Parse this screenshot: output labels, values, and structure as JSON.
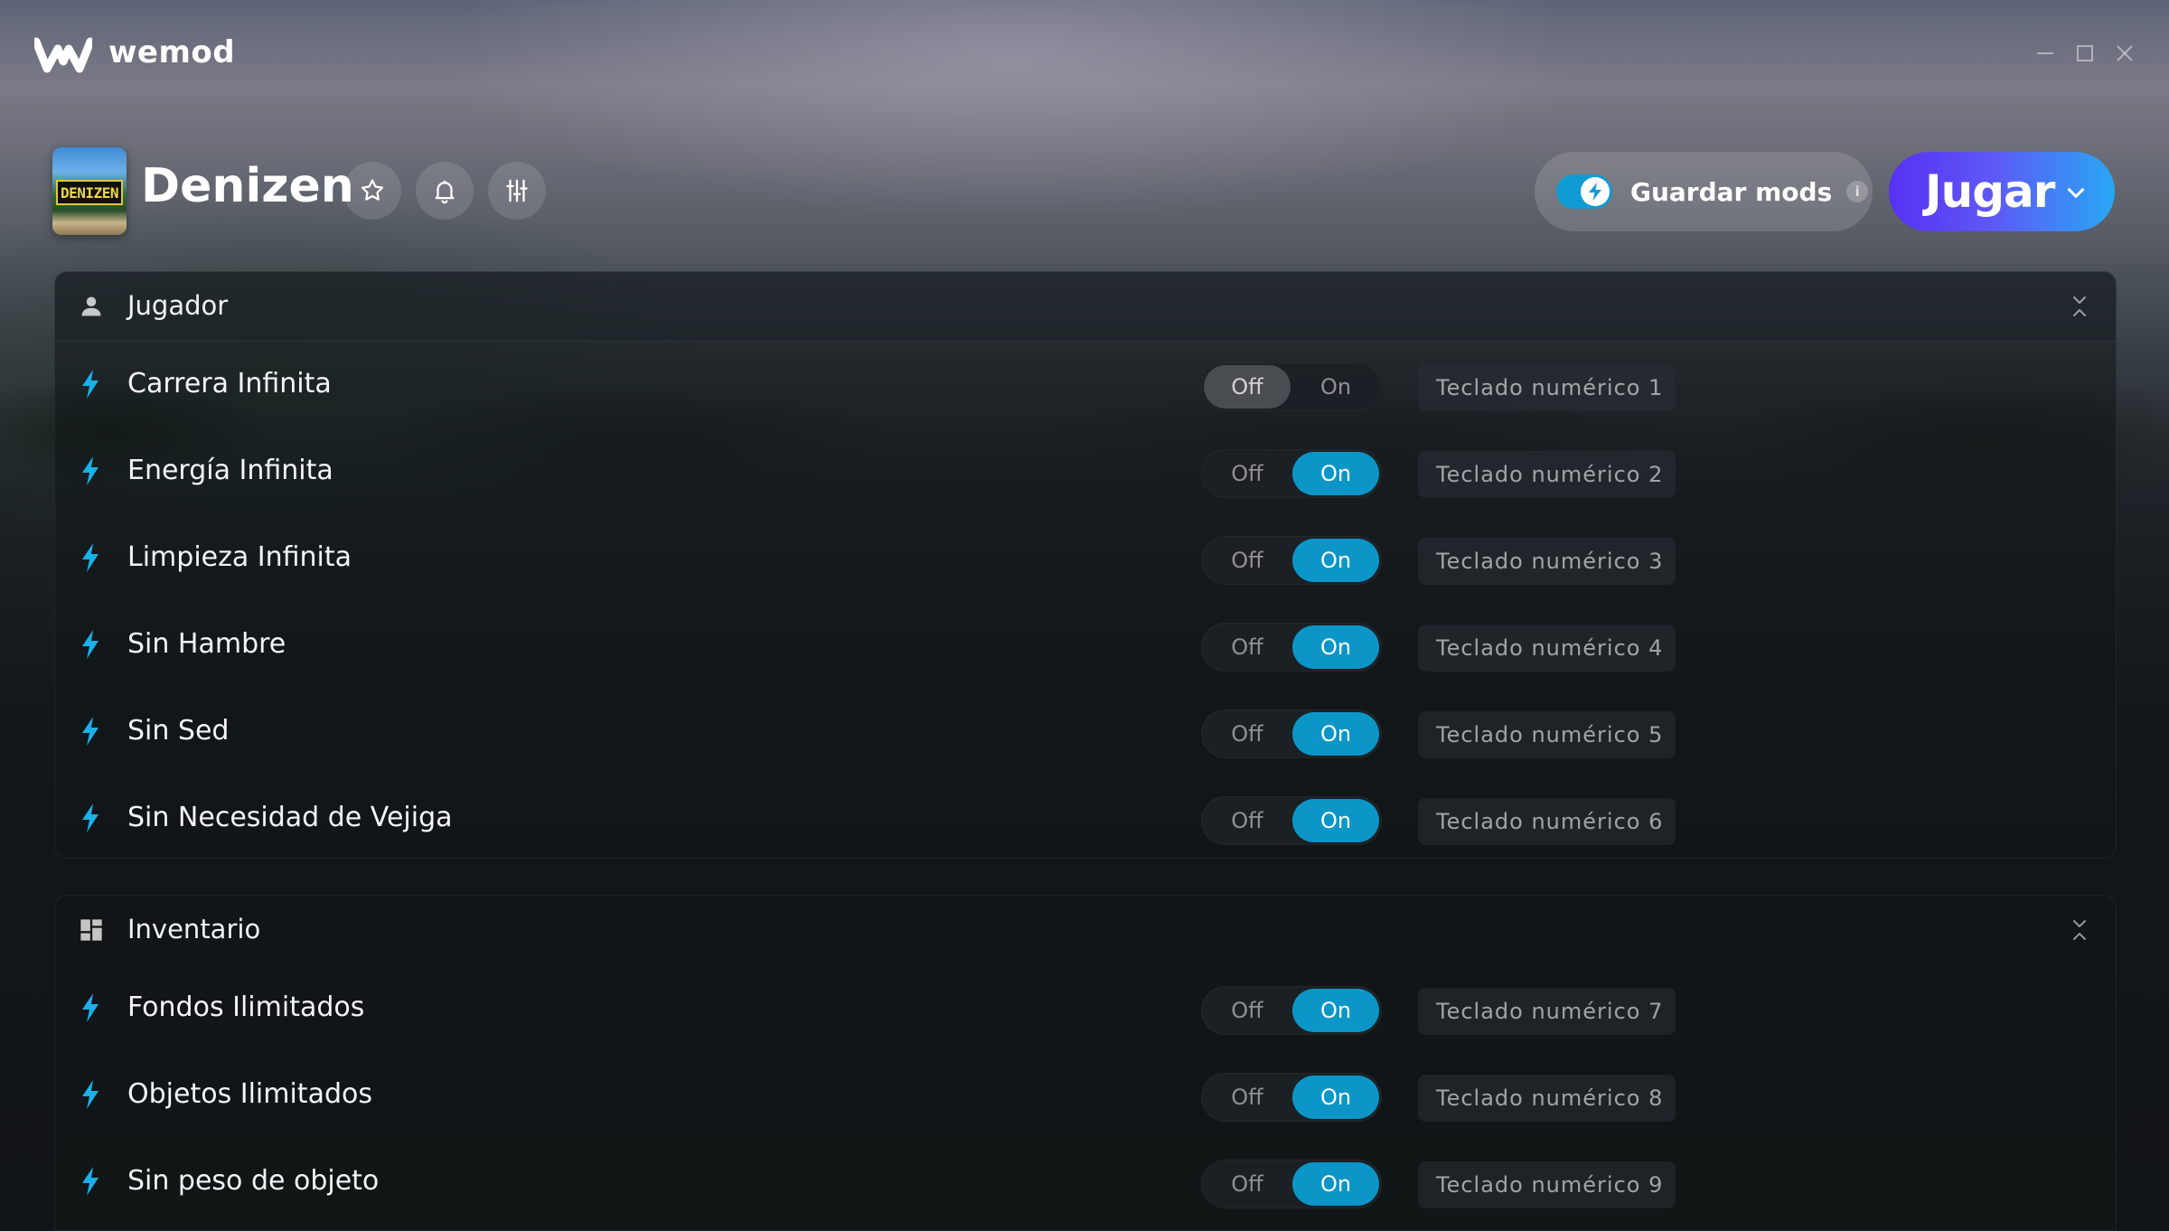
{
  "app": {
    "name": "wemod"
  },
  "window_controls": {
    "minimize_icon": "minimize-icon",
    "maximize_icon": "maximize-icon",
    "close_icon": "close-icon"
  },
  "game": {
    "title": "Denizen",
    "thumb_label": "DENIZEN",
    "actions": [
      "star-icon",
      "bell-icon",
      "sliders-icon"
    ]
  },
  "header": {
    "save_mods_label": "Guardar mods",
    "save_mods_enabled": true,
    "info_label": "i",
    "play_label": "Jugar"
  },
  "colors": {
    "accent": "#0b96c7",
    "bolt": "#1ab0e8",
    "play_start": "#5631f3",
    "play_end": "#28a8f5"
  },
  "sections": [
    {
      "title": "Jugador",
      "icon": "person-icon",
      "mods": [
        {
          "name": "Carrera Infinita",
          "state": "off",
          "off_label": "Off",
          "on_label": "On",
          "hotkey": "Teclado numérico 1"
        },
        {
          "name": "Energía Infinita",
          "state": "on",
          "off_label": "Off",
          "on_label": "On",
          "hotkey": "Teclado numérico 2"
        },
        {
          "name": "Limpieza Infinita",
          "state": "on",
          "off_label": "Off",
          "on_label": "On",
          "hotkey": "Teclado numérico 3"
        },
        {
          "name": "Sin Hambre",
          "state": "on",
          "off_label": "Off",
          "on_label": "On",
          "hotkey": "Teclado numérico 4"
        },
        {
          "name": "Sin Sed",
          "state": "on",
          "off_label": "Off",
          "on_label": "On",
          "hotkey": "Teclado numérico 5"
        },
        {
          "name": "Sin Necesidad de Vejiga",
          "state": "on",
          "off_label": "Off",
          "on_label": "On",
          "hotkey": "Teclado numérico 6"
        }
      ]
    },
    {
      "title": "Inventario",
      "icon": "grid-icon",
      "mods": [
        {
          "name": "Fondos Ilimitados",
          "state": "on",
          "off_label": "Off",
          "on_label": "On",
          "hotkey": "Teclado numérico 7"
        },
        {
          "name": "Objetos Ilimitados",
          "state": "on",
          "off_label": "Off",
          "on_label": "On",
          "hotkey": "Teclado numérico 8"
        },
        {
          "name": "Sin peso de objeto",
          "state": "on",
          "off_label": "Off",
          "on_label": "On",
          "hotkey": "Teclado numérico 9"
        }
      ]
    }
  ]
}
